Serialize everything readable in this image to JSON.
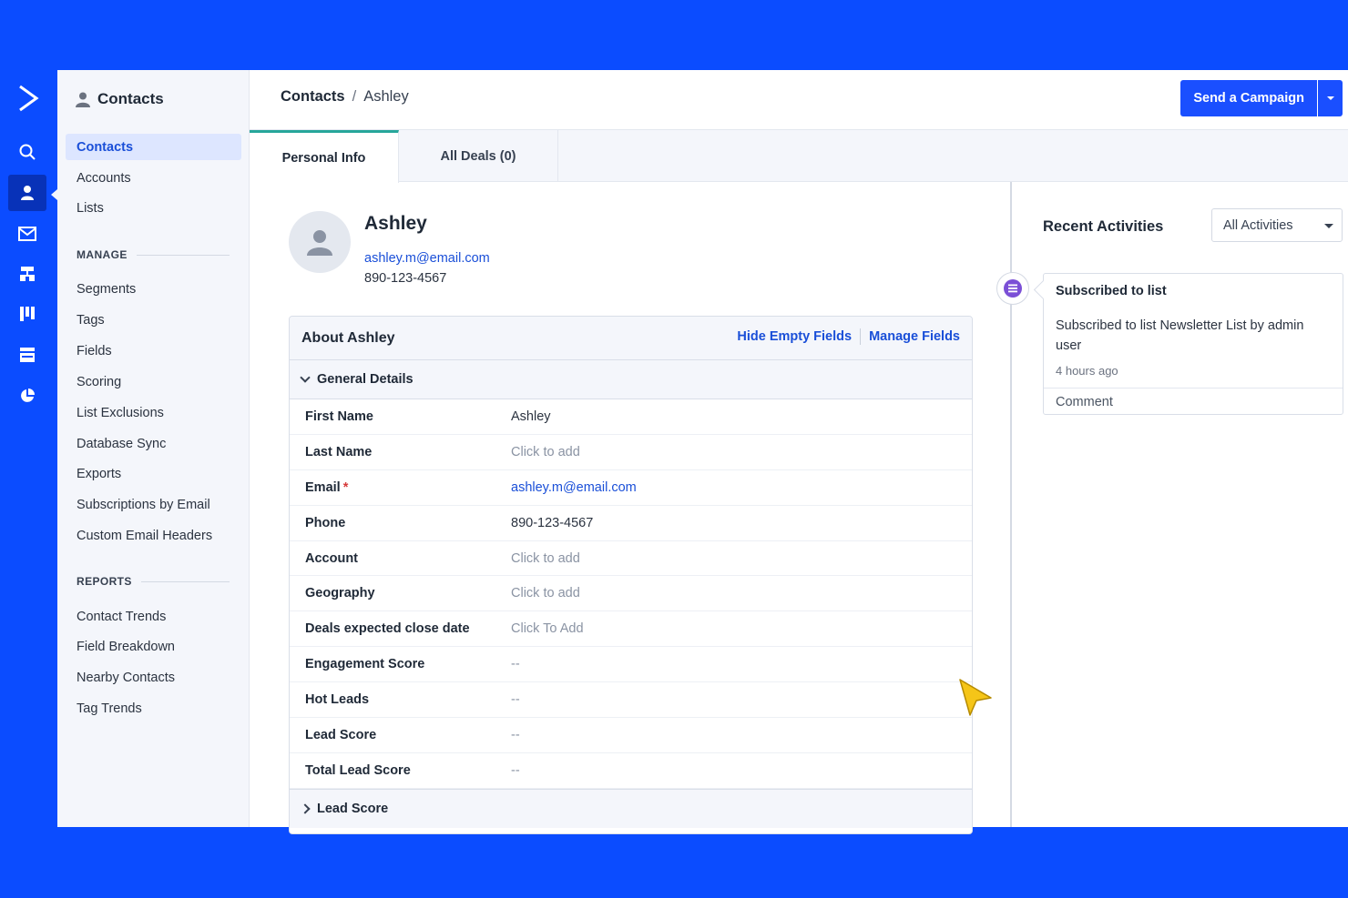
{
  "nav": {
    "header": "Contacts",
    "items_top": [
      "Contacts",
      "Accounts",
      "Lists"
    ],
    "manage_label": "MANAGE",
    "manage_items": [
      "Segments",
      "Tags",
      "Fields",
      "Scoring",
      "List Exclusions",
      "Database Sync",
      "Exports",
      "Subscriptions by Email",
      "Custom Email Headers"
    ],
    "reports_label": "REPORTS",
    "reports_items": [
      "Contact Trends",
      "Field Breakdown",
      "Nearby Contacts",
      "Tag Trends"
    ]
  },
  "breadcrumb": {
    "root": "Contacts",
    "separator": "/",
    "current": "Ashley"
  },
  "send_campaign_label": "Send a Campaign",
  "tabs": [
    "Personal Info",
    "All Deals (0)"
  ],
  "contact": {
    "name": "Ashley",
    "email": "ashley.m@email.com",
    "phone": "890-123-4567"
  },
  "about": {
    "title": "About Ashley",
    "hide_empty": "Hide Empty Fields",
    "manage_fields": "Manage Fields",
    "general_section": "General Details",
    "fields": [
      {
        "label": "First Name",
        "value": "Ashley",
        "kind": "text"
      },
      {
        "label": "Last Name",
        "value": "Click to add",
        "kind": "empty"
      },
      {
        "label": "Email",
        "value": "ashley.m@email.com",
        "kind": "link",
        "required": "*"
      },
      {
        "label": "Phone",
        "value": "890-123-4567",
        "kind": "text"
      },
      {
        "label": "Account",
        "value": "Click to add",
        "kind": "empty"
      },
      {
        "label": "Geography",
        "value": "Click to add",
        "kind": "empty"
      },
      {
        "label": "Deals expected close date",
        "value": "Click To Add",
        "kind": "empty"
      },
      {
        "label": "Engagement Score",
        "value": "--",
        "kind": "empty"
      },
      {
        "label": "Hot Leads",
        "value": "--",
        "kind": "empty"
      },
      {
        "label": "Lead Score",
        "value": "--",
        "kind": "empty"
      },
      {
        "label": "Total Lead Score",
        "value": "--",
        "kind": "empty"
      }
    ],
    "lead_section": "Lead Score"
  },
  "activities": {
    "title": "Recent Activities",
    "filter": "All Activities",
    "items": [
      {
        "title": "Subscribed to list",
        "detail": "Subscribed to list Newsletter List by admin user",
        "time": "4 hours ago",
        "comment": "Comment"
      }
    ]
  },
  "colors": {
    "brand": "#0b4cff",
    "link": "#1a4fd8",
    "tab_accent": "#26a69a",
    "activity_icon": "#7b4fd6"
  },
  "icons": [
    "logo-chevron-icon",
    "search-icon",
    "contacts-icon",
    "email-icon",
    "automation-icon",
    "pipeline-icon",
    "site-icon",
    "reports-icon",
    "activity-list-icon"
  ]
}
